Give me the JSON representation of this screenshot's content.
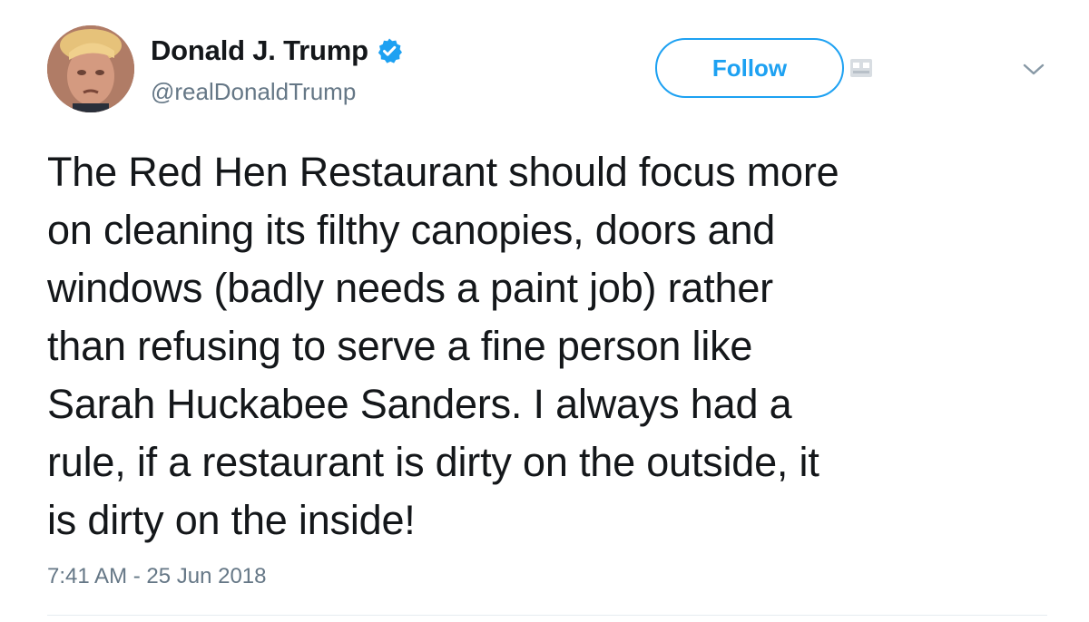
{
  "author": {
    "display_name": "Donald J. Trump",
    "handle": "@realDonaldTrump",
    "verified": true
  },
  "header": {
    "follow_label": "Follow"
  },
  "tweet": {
    "text": "The Red Hen Restaurant should focus more\non cleaning its filthy canopies, doors and\nwindows (badly needs a paint job) rather\nthan refusing to serve a fine person like\nSarah Huckabee Sanders. I always had a\nrule, if a restaurant is dirty on the outside, it\nis dirty on the inside!",
    "timestamp": "7:41 AM - 25 Jun 2018"
  },
  "icons": {
    "verified": "verified-badge-icon",
    "menu": "chevron-down-icon",
    "extension": "extension-icon"
  },
  "colors": {
    "accent": "#1da1f2",
    "text": "#14171a",
    "secondary": "#657786",
    "divider": "#e6ecf0"
  }
}
